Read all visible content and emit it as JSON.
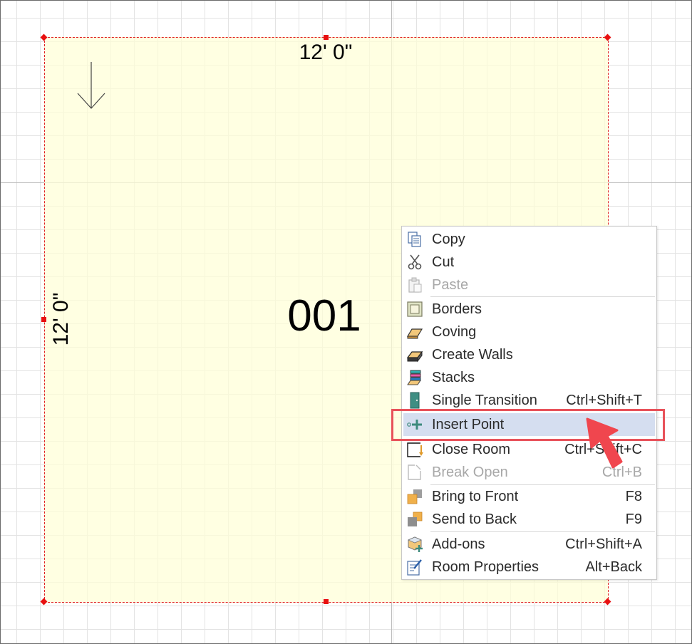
{
  "canvas": {
    "dimension_top": "12' 0\"",
    "dimension_left": "12' 0\"",
    "room_label": "001"
  },
  "colors": {
    "room_fill": "#ffffd7",
    "room_outline": "#e02020",
    "highlight": "#d5def0",
    "focus_box": "#e8525a",
    "pointer": "#f0464e"
  },
  "context_menu": {
    "items": [
      {
        "label": "Copy",
        "shortcut": "",
        "icon": "copy-icon",
        "enabled": true
      },
      {
        "label": "Cut",
        "shortcut": "",
        "icon": "scissors-icon",
        "enabled": true
      },
      {
        "label": "Paste",
        "shortcut": "",
        "icon": "clipboard-icon",
        "enabled": false
      },
      {
        "label": "Borders",
        "shortcut": "",
        "icon": "borders-icon",
        "enabled": true
      },
      {
        "label": "Coving",
        "shortcut": "",
        "icon": "coving-icon",
        "enabled": true
      },
      {
        "label": "Create Walls",
        "shortcut": "",
        "icon": "walls-icon",
        "enabled": true
      },
      {
        "label": "Stacks",
        "shortcut": "",
        "icon": "stacks-icon",
        "enabled": true
      },
      {
        "label": "Single Transition",
        "shortcut": "Ctrl+Shift+T",
        "icon": "door-icon",
        "enabled": true
      },
      {
        "label": "Insert Point",
        "shortcut": "",
        "icon": "insert-point-icon",
        "enabled": true,
        "highlighted": true
      },
      {
        "label": "Close Room",
        "shortcut": "Ctrl+Shift+C",
        "icon": "close-room-icon",
        "enabled": true
      },
      {
        "label": "Break Open",
        "shortcut": "Ctrl+B",
        "icon": "break-open-icon",
        "enabled": false
      },
      {
        "label": "Bring to Front",
        "shortcut": "F8",
        "icon": "bring-front-icon",
        "enabled": true
      },
      {
        "label": "Send to Back",
        "shortcut": "F9",
        "icon": "send-back-icon",
        "enabled": true
      },
      {
        "label": "Add-ons",
        "shortcut": "Ctrl+Shift+A",
        "icon": "add-ons-icon",
        "enabled": true
      },
      {
        "label": "Room Properties",
        "shortcut": "Alt+Back",
        "icon": "properties-icon",
        "enabled": true
      }
    ]
  }
}
